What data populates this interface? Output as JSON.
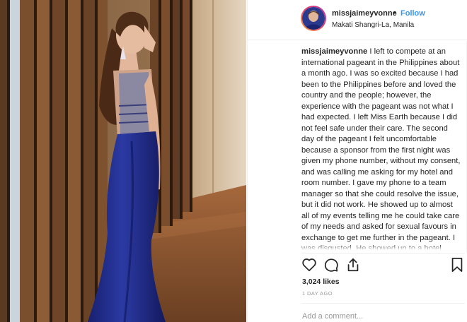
{
  "post": {
    "header": {
      "username": "missjaimeyvonne",
      "separator": "•",
      "follow_label": "Follow",
      "location": "Makati Shangri-La, Manila",
      "avatar_icon": "profile-photo"
    },
    "caption": {
      "username": "missjaimeyvonne",
      "text": "I left to compete at an international pageant in the Philippines about a month ago. I was so excited because I had been to the Philippines before and loved the country and the people; however, the experience with the pageant was not what I had expected. I left Miss Earth because I did not feel safe under their care. The second day of the pageant I felt uncomfortable because a sponsor from the first night was given my phone number, without my consent, and was calling me asking for my hotel and room number. I gave my phone to a team manager so that she could resolve the issue, but it did not work. He showed up to almost all of my events telling me he could take care of my needs and asked for sexual favours in exchange to get me further in the pageant. I was disgusted. He showed up to a hotel"
    },
    "actions": {
      "like_icon": "heart-icon",
      "comment_icon": "speech-bubble-icon",
      "share_icon": "share-arrow-icon",
      "save_icon": "bookmark-icon"
    },
    "likes": "3,024 likes",
    "timestamp": "1 DAY AGO",
    "comment": {
      "placeholder": "Add a comment..."
    },
    "colors": {
      "link_blue": "#3897f0",
      "text": "#262626",
      "muted": "#999999",
      "border": "#efefef",
      "dress_blue": "#1e2a84"
    }
  }
}
